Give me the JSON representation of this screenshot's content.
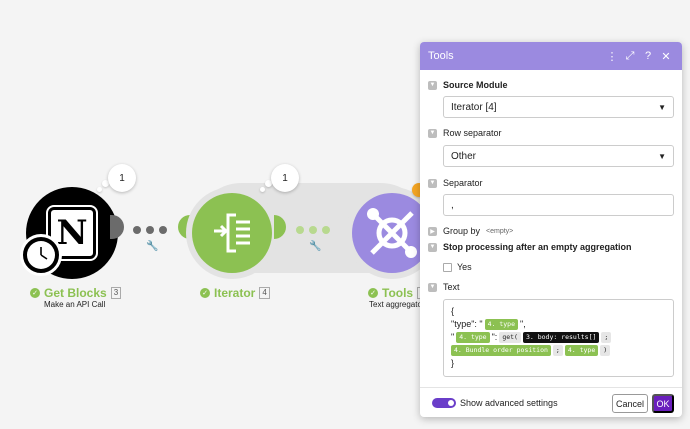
{
  "canvas": {
    "modules": [
      {
        "name": "Get Blocks",
        "id": "3",
        "subtitle": "Make an API Call",
        "counter": "1",
        "app": "Notion",
        "color": "#000000"
      },
      {
        "name": "Iterator",
        "id": "4",
        "subtitle": "",
        "counter": "1",
        "app": "Flow Control",
        "color": "#8cc152"
      },
      {
        "name": "Tools",
        "id": "5",
        "subtitle": "Text aggregator",
        "counter": "",
        "app": "Tools",
        "color": "#9b8ae0"
      }
    ],
    "colors": {
      "success": "#8cc152",
      "tools": "#9b8ae0",
      "accent": "#6a1fbd"
    }
  },
  "panel": {
    "title": "Tools",
    "header_icons": [
      "more-vertical-icon",
      "expand-icon",
      "help-icon",
      "close-icon"
    ],
    "source_module": {
      "label": "Source Module",
      "value": "Iterator [4]"
    },
    "row_separator": {
      "label": "Row separator",
      "value": "Other"
    },
    "separator": {
      "label": "Separator",
      "value": ","
    },
    "group_by": {
      "label": "Group by",
      "tag": "<empty>"
    },
    "stop_processing": {
      "label": "Stop processing after an empty aggregation",
      "option": "Yes",
      "checked": false
    },
    "text": {
      "label": "Text",
      "line1": "{",
      "line2_key": "\"type\": \"",
      "line2_pill": "4. type",
      "line2_end": "\",",
      "line3_open": "\"",
      "line3_pill": "4. type",
      "line3_mid": "\":",
      "line3_fn": "get(",
      "line3_path": "3. body: results[]",
      "line3_sep": ";",
      "line4_pill1": "4. Bundle order position",
      "line4_sep": ";",
      "line4_pill2": "4. type",
      "line4_close": ")",
      "line5": "}"
    },
    "footer": {
      "advanced_label": "Show advanced settings",
      "advanced_on": true,
      "cancel": "Cancel",
      "ok": "OK"
    }
  }
}
